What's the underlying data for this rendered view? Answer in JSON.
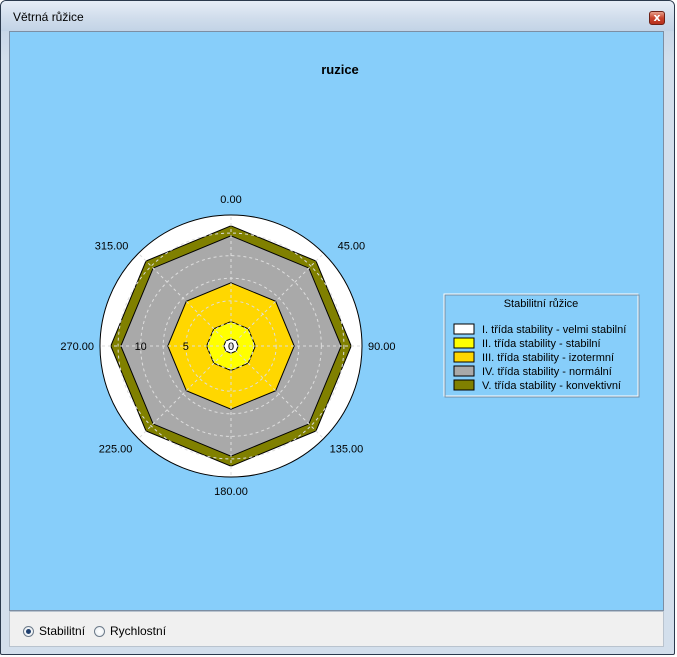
{
  "window": {
    "title": "Větrná růžice"
  },
  "titlebar": {
    "close_label": "x"
  },
  "colors": {
    "chart_background": "#87cefa",
    "class1": "#ffffff",
    "class2": "#ffff00",
    "class3": "#ffd700",
    "class4": "#a9a9a9",
    "class5": "#808000"
  },
  "chart_data": {
    "type": "polar-area",
    "title": "ruzice",
    "angles": [
      "0.00",
      "45.00",
      "90.00",
      "135.00",
      "180.00",
      "225.00",
      "270.00",
      "315.00"
    ],
    "radial_ticks": [
      "0",
      "5",
      "10"
    ],
    "rmax": 14.5,
    "grid": true,
    "legend": {
      "title": "Stabilitní růžice",
      "placement": "right"
    },
    "series": [
      {
        "name": "V. třída stability - konvektivní",
        "color": "#808000",
        "values": [
          13.3,
          13.3,
          13.3,
          13.3,
          13.3,
          13.3,
          13.3,
          13.3
        ]
      },
      {
        "name": "IV. třída stability - normální",
        "color": "#a9a9a9",
        "values": [
          12.2,
          12.2,
          12.2,
          12.2,
          12.2,
          12.2,
          12.2,
          12.2
        ]
      },
      {
        "name": "III. třída stability - izotermní",
        "color": "#ffd700",
        "values": [
          7.0,
          7.0,
          7.0,
          7.0,
          7.0,
          7.0,
          7.0,
          7.0
        ]
      },
      {
        "name": "II. třída stability - stabilní",
        "color": "#ffff00",
        "values": [
          2.7,
          2.7,
          2.7,
          2.7,
          2.7,
          2.7,
          2.7,
          2.7
        ]
      },
      {
        "name": "I. třída stability - velmi stabilní",
        "color": "#ffffff",
        "values": [
          0.8,
          0.8,
          0.8,
          0.8,
          0.8,
          0.8,
          0.8,
          0.8
        ]
      }
    ]
  },
  "bottom": {
    "options": [
      {
        "label": "Stabilitní",
        "checked": true
      },
      {
        "label": "Rychlostní",
        "checked": false
      }
    ]
  }
}
